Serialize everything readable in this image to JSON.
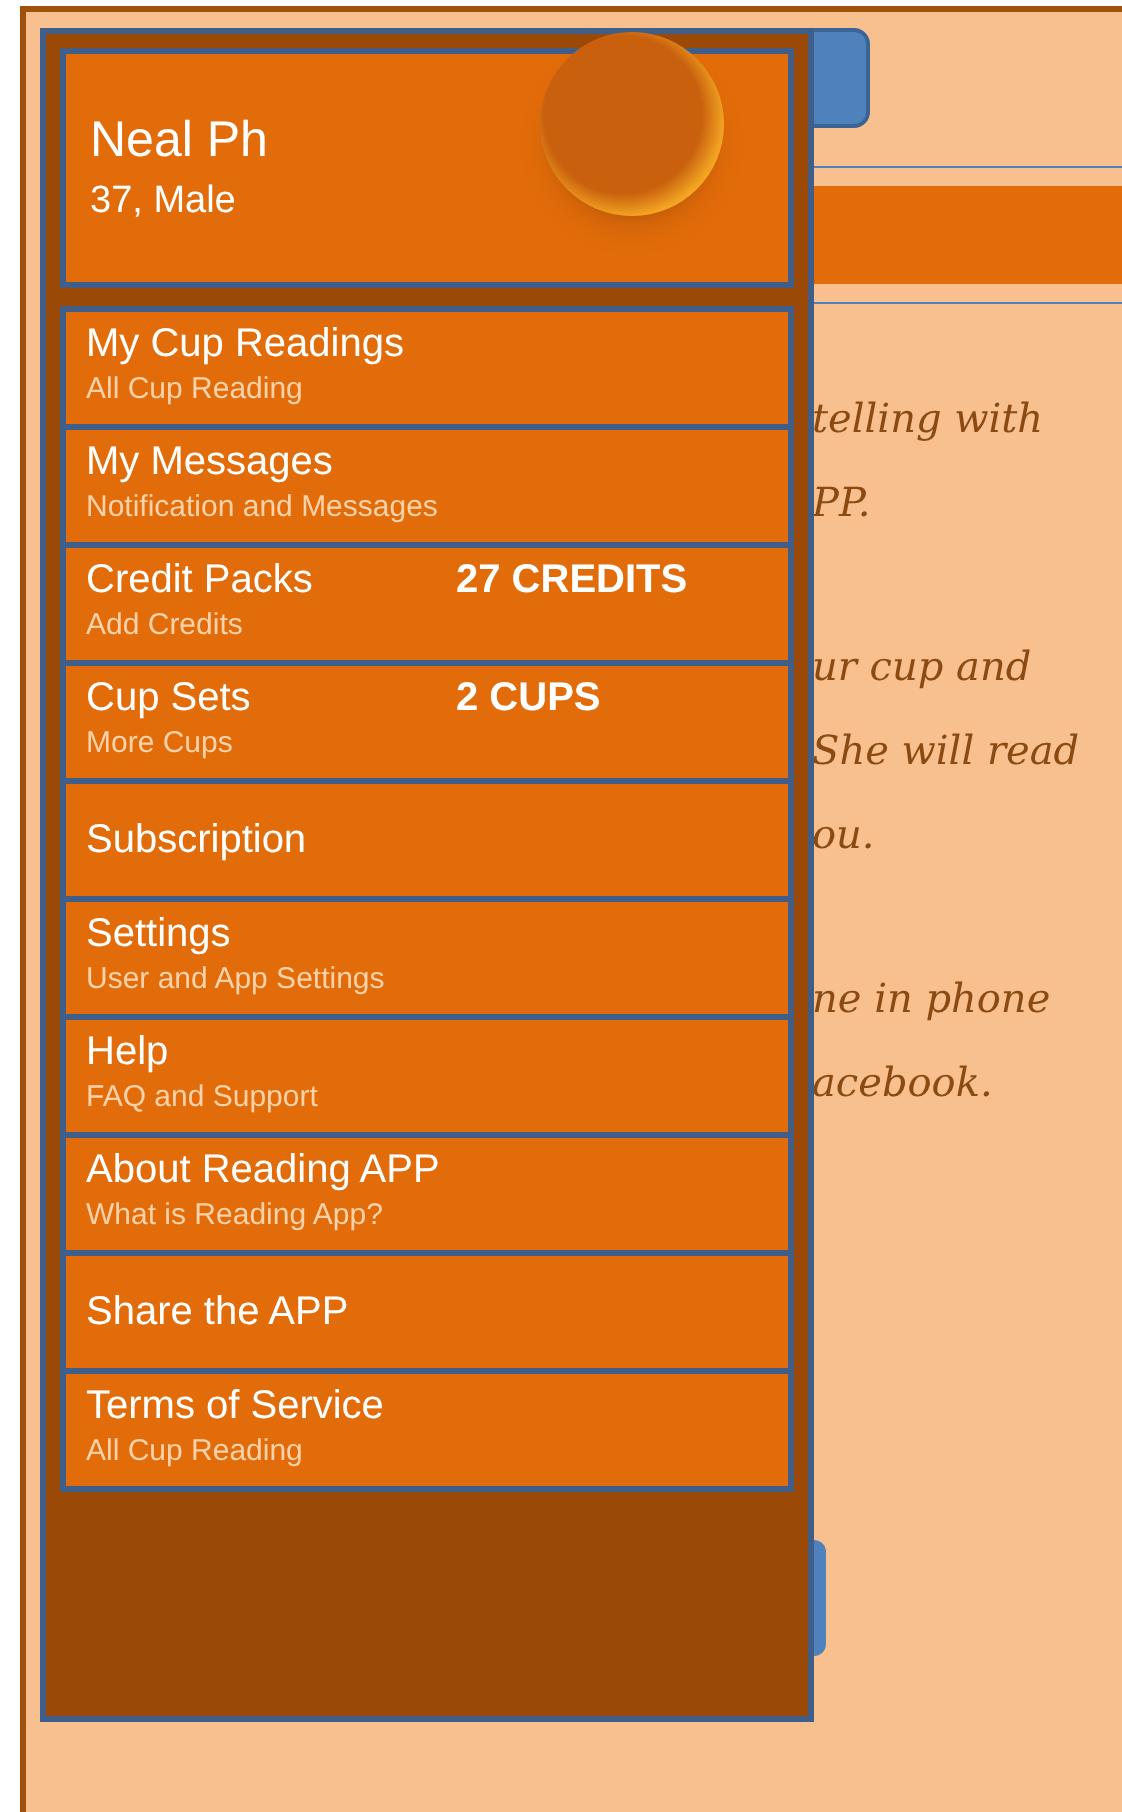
{
  "profile": {
    "name": "Neal Ph",
    "details": "37, Male"
  },
  "menu": [
    {
      "title": "My Cup Readings",
      "subtitle": "All Cup Reading"
    },
    {
      "title": "My Messages",
      "subtitle": "Notification and Messages"
    },
    {
      "title": "Credit Packs",
      "subtitle": "Add Credits",
      "badge": "27 CREDITS"
    },
    {
      "title": "Cup Sets",
      "subtitle": "More Cups",
      "badge": "2 CUPS"
    },
    {
      "title": "Subscription"
    },
    {
      "title": "Settings",
      "subtitle": "User and App Settings"
    },
    {
      "title": "Help",
      "subtitle": "FAQ and Support"
    },
    {
      "title": "About Reading APP",
      "subtitle": "What is Reading App?"
    },
    {
      "title": "Share the APP"
    },
    {
      "title": "Terms of Service",
      "subtitle": "All Cup Reading"
    }
  ],
  "background_text": [
    [
      "telling with",
      "PP."
    ],
    [
      "ur cup and",
      "She will read",
      "ou."
    ],
    [
      "ne in phone",
      "acebook."
    ]
  ]
}
